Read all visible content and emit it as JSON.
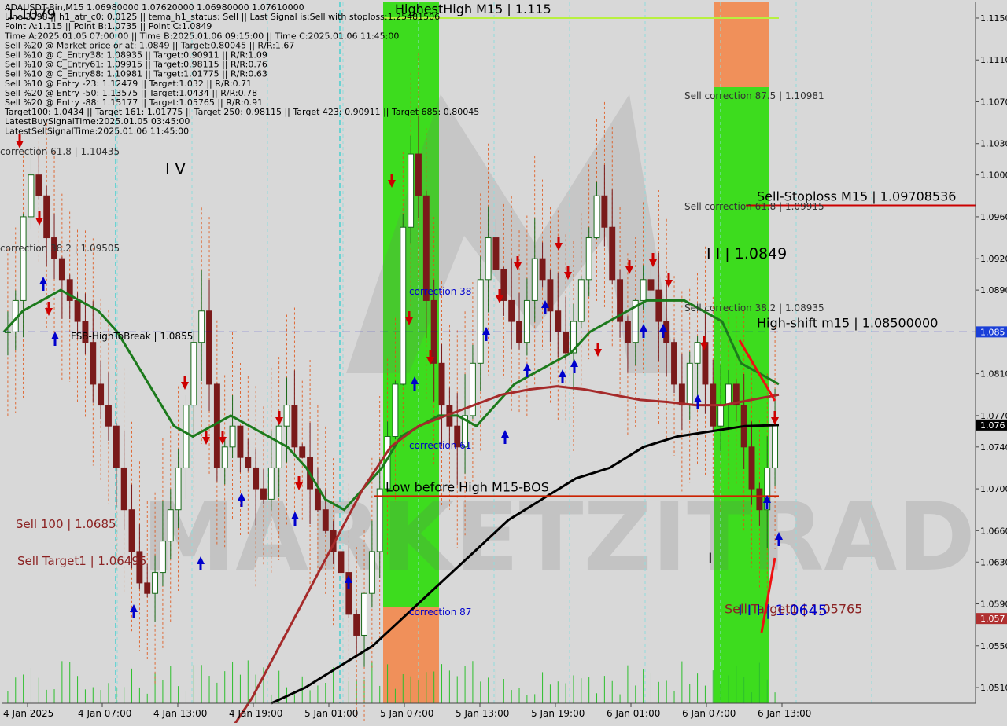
{
  "header": {
    "lines": [
      "ADAUSDT-Bin,M15  1.06980000 1.07620000 1.06980000 1.07610000",
      "Line:3398 || h1_atr_c0: 0.0125 || tema_h1_status: Sell || Last Signal is:Sell with stoploss:1.25481506",
      "Point A:1.115 || Point B:1.0735 || Point C:1.0849",
      "Time A:2025.01.05 07:00:00 || Time B:2025.01.06 09:15:00 || Time C:2025.01.06 11:45:00",
      "Sell %20 @ Market price or at: 1.0849 || Target:0.80045 || R/R:1.67",
      "Sell %10 @ C_Entry38: 1.08935 || Target:0.90911 || R/R:1.09",
      "Sell %10 @ C_Entry61: 1.09915 || Target:0.98115 || R/R:0.76",
      "Sell %10 @ C_Entry88: 1.10981 || Target:1.01775 || R/R:0.63",
      "Sell %10 @ Entry -23: 1.12479 || Target:1.032 || R/R:0.71",
      "Sell %20 @ Entry -50: 1.13575 || Target:1.0434 || R/R:0.78",
      "Sell %20 @ Entry -88: 1.15177 || Target:1.05765 || R/R:0.91",
      "Target100: 1.0434 || Target 161: 1.01775 || Target 250: 0.98115 || Target 423: 0.90911 || Target 685: 0.80045",
      "LatestBuySignalTime:2025.01.05 03:45:00",
      "LatestSellSignalTime:2025.01.06 11:45:00"
    ],
    "top_left_price": "1.1079"
  },
  "watermark": "MARKETZITRADE",
  "colors": {
    "background": "#d8d8d8",
    "grid": "#8fdcdc",
    "green_zone": "#3ddc1e",
    "orange_zone": "#f0905a",
    "bull_candle": "#1a6a1a",
    "bear_candle": "#7a1a1a",
    "ma_green": "#1c7a1c",
    "ma_red": "#a52a2a",
    "ma_black": "#000000",
    "sell_red": "#cc0000",
    "buy_blue": "#0000cc",
    "highest_line": "#b8f040",
    "price_label_bg": "#e0ffff"
  },
  "chart_data": {
    "type": "candlestick",
    "symbol": "ADAUSDT-Bin",
    "timeframe": "M15",
    "ohlc_current": {
      "open": 1.0698,
      "high": 1.0762,
      "low": 1.0698,
      "close": 1.0761
    },
    "ylim": [
      1.0495,
      1.1165
    ],
    "y_ticks": [
      "1.1150",
      "1.1110",
      "1.1070",
      "1.1030",
      "1.1000",
      "1.0960",
      "1.0920",
      "1.0890",
      "1.0810",
      "1.0770",
      "1.0740",
      "1.0700",
      "1.0660",
      "1.0630",
      "1.0590",
      "1.0550",
      "1.0510"
    ],
    "y_tick_values": [
      1.115,
      1.111,
      1.107,
      1.103,
      1.1,
      1.096,
      1.092,
      1.089,
      1.081,
      1.077,
      1.074,
      1.07,
      1.066,
      1.063,
      1.059,
      1.055,
      1.051
    ],
    "x_ticks": [
      "4 Jan 2025",
      "4 Jan 07:00",
      "4 Jan 13:00",
      "4 Jan 19:00",
      "5 Jan 01:00",
      "5 Jan 07:00",
      "5 Jan 13:00",
      "5 Jan 19:00",
      "6 Jan 01:00",
      "6 Jan 07:00",
      "6 Jan 13:00"
    ],
    "price_tags": [
      {
        "label": "1.085",
        "value": 1.085
      },
      {
        "label": "1.076",
        "value": 1.0761
      },
      {
        "label": "1.057",
        "value": 1.0576
      }
    ],
    "close_series": [
      1.085,
      1.088,
      1.096,
      1.1,
      1.098,
      1.094,
      1.092,
      1.09,
      1.088,
      1.086,
      1.084,
      1.08,
      1.078,
      1.076,
      1.072,
      1.068,
      1.064,
      1.061,
      1.06,
      1.062,
      1.065,
      1.068,
      1.072,
      1.078,
      1.084,
      1.087,
      1.08,
      1.072,
      1.074,
      1.076,
      1.073,
      1.072,
      1.07,
      1.069,
      1.072,
      1.076,
      1.078,
      1.074,
      1.073,
      1.07,
      1.068,
      1.066,
      1.064,
      1.062,
      1.058,
      1.056,
      1.06,
      1.064,
      1.07,
      1.075,
      1.08,
      1.095,
      1.102,
      1.098,
      1.088,
      1.082,
      1.078,
      1.076,
      1.074,
      1.077,
      1.082,
      1.09,
      1.094,
      1.091,
      1.088,
      1.086,
      1.084,
      1.088,
      1.092,
      1.09,
      1.087,
      1.085,
      1.083,
      1.086,
      1.09,
      1.094,
      1.098,
      1.095,
      1.09,
      1.086,
      1.084,
      1.088,
      1.09,
      1.089,
      1.086,
      1.084,
      1.08,
      1.078,
      1.082,
      1.084,
      1.08,
      1.076,
      1.078,
      1.08,
      1.078,
      1.074,
      1.07,
      1.068,
      1.072,
      1.0761
    ],
    "ma_green": [
      1.085,
      1.087,
      1.088,
      1.089,
      1.088,
      1.087,
      1.085,
      1.082,
      1.079,
      1.076,
      1.075,
      1.076,
      1.077,
      1.076,
      1.075,
      1.074,
      1.072,
      1.069,
      1.068,
      1.07,
      1.072,
      1.075,
      1.076,
      1.077,
      1.077,
      1.076,
      1.078,
      1.08,
      1.081,
      1.082,
      1.083,
      1.085,
      1.086,
      1.087,
      1.088,
      1.088,
      1.088,
      1.087,
      1.086,
      1.082,
      1.081,
      1.08
    ],
    "ma_red": [
      1.046,
      1.05,
      1.055,
      1.06,
      1.065,
      1.07,
      1.074,
      1.076,
      1.077,
      1.078,
      1.079,
      1.0795,
      1.0798,
      1.0795,
      1.079,
      1.0785,
      1.0783,
      1.078,
      1.078,
      1.0785,
      1.079
    ],
    "ma_black": [
      1.0495,
      1.051,
      1.053,
      1.055,
      1.058,
      1.061,
      1.064,
      1.067,
      1.069,
      1.071,
      1.072,
      1.074,
      1.075,
      1.0755,
      1.076,
      1.0761
    ],
    "levels": [
      {
        "label": "HighestHigh   M15 | 1.115",
        "value": 1.115,
        "color": "#b8f040"
      },
      {
        "label": "Sell-Stoploss M15 | 1.09708536",
        "value": 1.09708536,
        "color": "#cc0000"
      },
      {
        "label": "High-shift m15 | 1.08500000",
        "value": 1.085,
        "color": "#0000cc"
      },
      {
        "label": "Low before High   M15-BOS",
        "value": 1.0693,
        "color": "#cc2200"
      },
      {
        "label": "Sell Target1 | 1.05765",
        "value": 1.05765,
        "color": "#8b2222"
      }
    ],
    "annotations": [
      {
        "text": "correction 61.8 | 1.10435",
        "color": "#333333"
      },
      {
        "text": "correction 38.2 | 1.09505",
        "color": "#333333"
      },
      {
        "text": "FSB-HighToBreak | 1.0855",
        "color": "#000000"
      },
      {
        "text": "Sell 100 | 1.0685",
        "color": "#8b2222"
      },
      {
        "text": "Sell Target1 | 1.06495",
        "color": "#8b2222"
      },
      {
        "text": "I V",
        "color": "#000000"
      },
      {
        "text": "correction 38",
        "color": "#0000cc"
      },
      {
        "text": "correction 61",
        "color": "#0000cc"
      },
      {
        "text": "correction 87",
        "color": "#0000cc"
      },
      {
        "text": "Sell correction 87.5 | 1.10981",
        "color": "#333333"
      },
      {
        "text": "Sell correction 61.8 | 1.09915",
        "color": "#333333"
      },
      {
        "text": "Sell correction 38.2 | 1.08935",
        "color": "#333333"
      },
      {
        "text": "I I | 1.0849",
        "color": "#000000"
      },
      {
        "text": "I I I | 1.0645",
        "color": "#0000cc"
      },
      {
        "text": "I",
        "color": "#000000"
      }
    ],
    "grid": true,
    "legend": "none"
  }
}
